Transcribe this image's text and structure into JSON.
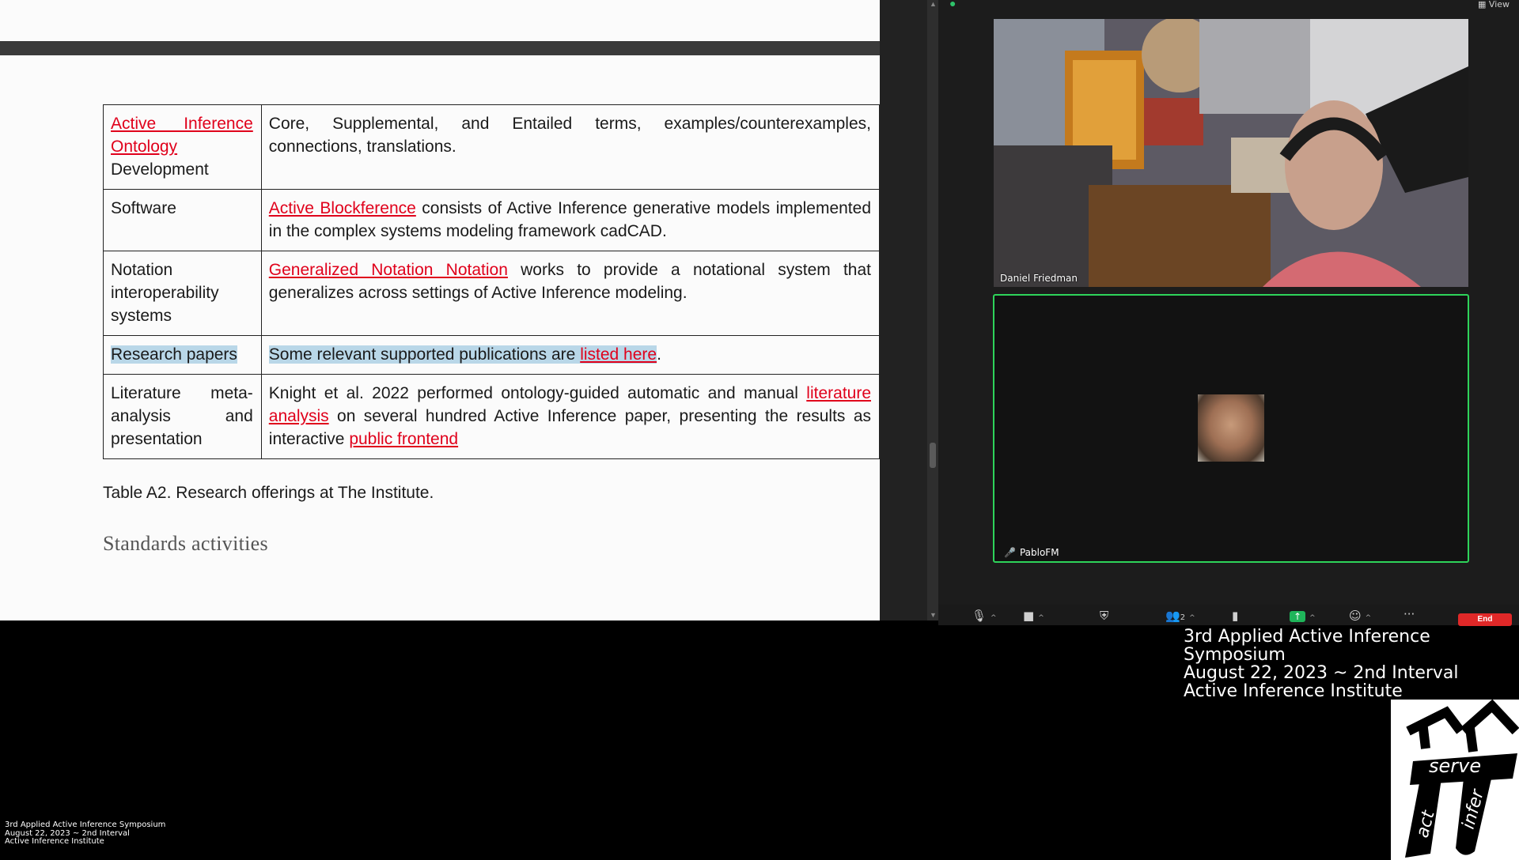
{
  "document": {
    "table": {
      "rows": [
        {
          "label_parts": [
            {
              "text": "Active Inference Ontology",
              "link": true
            },
            {
              "text": " Development",
              "link": false
            }
          ],
          "desc_parts": [
            {
              "text": "Core, Supplemental, and Entailed terms, examples/counterexamples, connections, translations.",
              "link": false
            }
          ]
        },
        {
          "label_parts": [
            {
              "text": "Software",
              "link": false
            }
          ],
          "desc_parts": [
            {
              "text": "Active Blockference",
              "link": true
            },
            {
              "text": " consists of Active Inference generative models implemented in the complex systems modeling framework cadCAD.",
              "link": false
            }
          ]
        },
        {
          "label_parts": [
            {
              "text": "Notation interoperability systems",
              "link": false
            }
          ],
          "desc_parts": [
            {
              "text": "Generalized Notation Notation",
              "link": true
            },
            {
              "text": " works to provide a notational system that generalizes across settings of Active Inference modeling.",
              "link": false
            }
          ]
        },
        {
          "label_parts": [
            {
              "text": "Research papers",
              "link": false,
              "highlight": true
            }
          ],
          "desc_parts": [
            {
              "text": "Some relevant supported publications are ",
              "link": false,
              "highlight": true
            },
            {
              "text": "listed here",
              "link": true,
              "highlight": true
            },
            {
              "text": ".",
              "link": false
            }
          ]
        },
        {
          "label_parts": [
            {
              "text": "Literature meta-analysis and presentation",
              "link": false
            }
          ],
          "desc_parts": [
            {
              "text": "Knight et al. 2022 performed ontology-guided automatic and manual ",
              "link": false
            },
            {
              "text": "literature analysis",
              "link": true
            },
            {
              "text": " on several hundred Active Inference paper, presenting the results as interactive ",
              "link": false
            },
            {
              "text": "public frontend",
              "link": true
            }
          ]
        }
      ]
    },
    "caption": "Table A2. Research offerings at The Institute.",
    "next_heading": "Standards activities"
  },
  "meeting": {
    "view_label": "View",
    "participants": [
      {
        "name": "Daniel Friedman",
        "active_speaker": false
      },
      {
        "name": "PabloFM",
        "active_speaker": true,
        "muted": true
      }
    ],
    "toolbar": {
      "participants_count": "2",
      "end_label": "End"
    },
    "colors": {
      "active_border": "#2ed35a",
      "end_button": "#e02828",
      "link": "#e0001b",
      "highlight": "#b9d7e8"
    }
  },
  "overlay": {
    "lines": [
      "3rd Applied Active Inference Symposium",
      "August 22, 2023 ~ 2nd Interval",
      "Active Inference Institute"
    ],
    "small_lines": [
      "3rd Applied Active Inference Symposium",
      "August 22, 2023 ~ 2nd Interval",
      "Active Inference Institute"
    ],
    "logo_words": [
      "serve",
      "act",
      "infer"
    ]
  }
}
